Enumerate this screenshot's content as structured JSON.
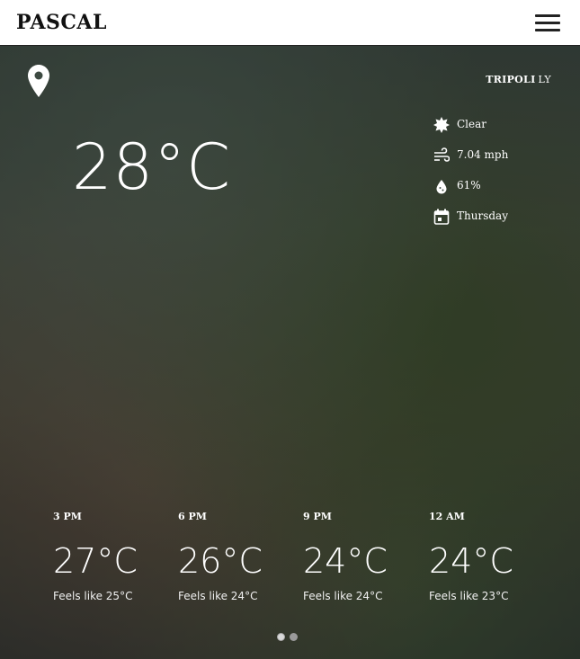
{
  "header": {
    "brand": "PASCAL",
    "menu_icon": "hamburger-menu-icon"
  },
  "location": {
    "city": "TRIPOLI",
    "country": "LY",
    "icon": "location-pin-icon"
  },
  "current": {
    "temperature": "28°C"
  },
  "conditions": [
    {
      "icon": "sun-icon",
      "label": "Clear"
    },
    {
      "icon": "wind-icon",
      "label": "7.04 mph"
    },
    {
      "icon": "humidity-drop-icon",
      "label": "61%"
    },
    {
      "icon": "calendar-icon",
      "label": "Thursday"
    }
  ],
  "forecast": [
    {
      "time": "3 PM",
      "temp": "27°C",
      "feels": "Feels like 25°C"
    },
    {
      "time": "6 PM",
      "temp": "26°C",
      "feels": "Feels like 24°C"
    },
    {
      "time": "9 PM",
      "temp": "24°C",
      "feels": "Feels like 24°C"
    },
    {
      "time": "12 AM",
      "temp": "24°C",
      "feels": "Feels like 23°C"
    }
  ],
  "pager": {
    "pages": 2,
    "active_index": 0
  }
}
